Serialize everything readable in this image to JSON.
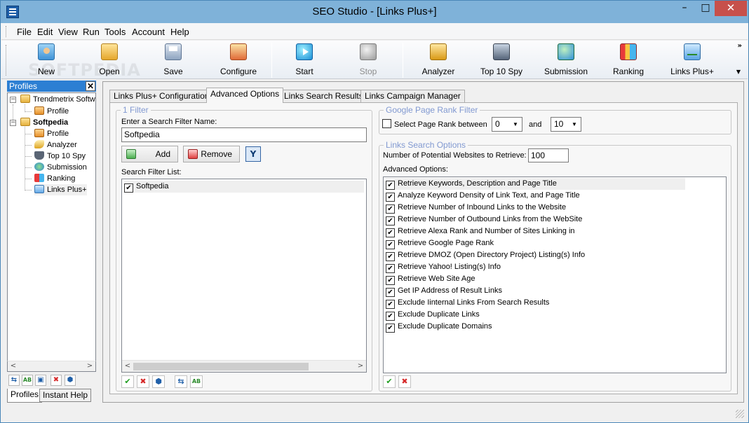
{
  "window": {
    "title": "SEO Studio - [Links Plus+]",
    "minimize": "–",
    "maximize": "□",
    "close": "✕"
  },
  "menu": [
    "File",
    "Edit",
    "View",
    "Run",
    "Tools",
    "Account",
    "Help"
  ],
  "watermark": "SOFTPEDIA",
  "toolbar": {
    "buttons": [
      {
        "label": "New",
        "icon": "new-profile-icon"
      },
      {
        "label": "Open",
        "icon": "open-folder-icon"
      },
      {
        "label": "Save",
        "icon": "save-icon"
      },
      {
        "label": "Configure",
        "icon": "configure-icon"
      },
      {
        "label": "Start",
        "icon": "start-play-icon"
      },
      {
        "label": "Stop",
        "icon": "stop-icon"
      },
      {
        "label": "Analyzer",
        "icon": "analyzer-key-icon"
      },
      {
        "label": "Top 10 Spy",
        "icon": "spy-icon"
      },
      {
        "label": "Submission",
        "icon": "submission-globe-icon"
      },
      {
        "label": "Ranking",
        "icon": "ranking-icon"
      },
      {
        "label": "Links Plus+",
        "icon": "links-plus-icon"
      }
    ],
    "more": "»",
    "more_down": "▼"
  },
  "profiles_panel": {
    "title": "Profiles",
    "close": "✕",
    "tree": {
      "root1": {
        "label": "Trendmetrix Softw",
        "children": [
          "Profile"
        ]
      },
      "root2": {
        "label": "Softpedia",
        "children": [
          "Profile",
          "Analyzer",
          "Top 10 Spy",
          "Submission",
          "Ranking",
          "Links Plus+"
        ]
      }
    },
    "scroll_left": "<",
    "scroll_right": ">",
    "tools": [
      "⇆",
      "AB",
      "▣",
      "✖",
      "⬢"
    ],
    "tabs": [
      "Profiles",
      "Instant Help"
    ]
  },
  "tabs": [
    "Links Plus+ Configuration",
    "Advanced Options",
    "Links Search Results",
    "Links Campaign Manager"
  ],
  "filter": {
    "legend": "1 Filter",
    "name_label": "Enter a Search Filter Name:",
    "name_value": "Softpedia",
    "add": "Add",
    "remove": "Remove",
    "filter_icon": "Y",
    "list_label": "Search Filter List:",
    "list": [
      {
        "label": "Softpedia",
        "checked": "✔"
      }
    ],
    "scroll_left": "<",
    "scroll_right": ">",
    "bottom_tools": [
      "✔",
      "✖",
      "⬢",
      "⇆",
      "AB"
    ]
  },
  "pagerank": {
    "legend": "Google Page Rank Filter",
    "label": "Select Page Rank between",
    "from": "0",
    "and": "and",
    "to": "10",
    "arrow": "▼"
  },
  "links_search": {
    "legend": "Links Search Options",
    "potential_label": "Number of Potential Websites to Retrieve:",
    "potential_value": "100",
    "advanced_label": "Advanced Options:",
    "check": "✔",
    "options": [
      "Retrieve Keywords, Description and Page Title",
      "Analyze Keyword Density of Link Text, and Page Title",
      "Retrieve Number of Inbound Links to the Website",
      "Retrieve Number of Outbound Links from the WebSite",
      "Retrieve Alexa Rank and Number of Sites Linking in",
      "Retrieve Google Page Rank",
      "Retrieve DMOZ (Open Directory Project) Listing(s) Info",
      "Retrieve Yahoo! Listing(s) Info",
      "Retrieve Web Site Age",
      "Get IP Address of Result Links",
      "Exclude Iinternal Links From Search Results",
      "Exclude Duplicate Links",
      "Exclude Duplicate Domains"
    ],
    "bottom_tools": [
      "✔",
      "✖"
    ]
  }
}
